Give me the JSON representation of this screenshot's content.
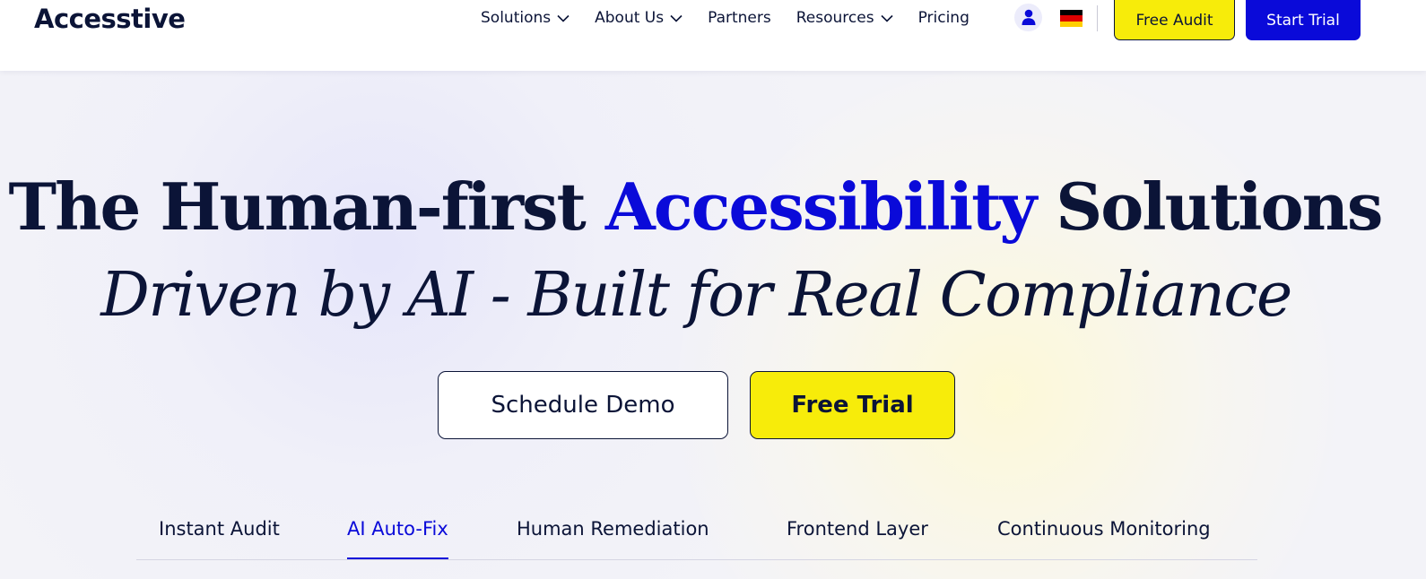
{
  "brand": {
    "name": "Accesstive"
  },
  "nav": {
    "items": [
      {
        "label": "Solutions",
        "has_dropdown": true
      },
      {
        "label": "About Us",
        "has_dropdown": true
      },
      {
        "label": "Partners",
        "has_dropdown": false
      },
      {
        "label": "Resources",
        "has_dropdown": true
      },
      {
        "label": "Pricing",
        "has_dropdown": false
      }
    ],
    "icons": [
      "user-icon",
      "german-flag-icon"
    ],
    "free_audit_label": "Free Audit",
    "start_trial_label": "Start Trial"
  },
  "hero": {
    "title_part1": "The Human-first",
    "title_accent": "Accessibility",
    "title_part2": "Solutions",
    "subtitle": "Driven by AI - Built for Real Compliance",
    "demo_button": "Schedule Demo",
    "trial_button": "Free Trial"
  },
  "tabs": [
    {
      "label": "Instant Audit",
      "active": false
    },
    {
      "label": "AI Auto-Fix",
      "active": true
    },
    {
      "label": "Human Remediation",
      "active": false
    },
    {
      "label": "Frontend Layer",
      "active": false
    },
    {
      "label": "Continuous Monitoring",
      "active": false
    }
  ],
  "colors": {
    "primary": "#0a0ad9",
    "accent_yellow": "#f7ec0a",
    "text_dark": "#0b1437",
    "background": "#f3f3f8"
  }
}
